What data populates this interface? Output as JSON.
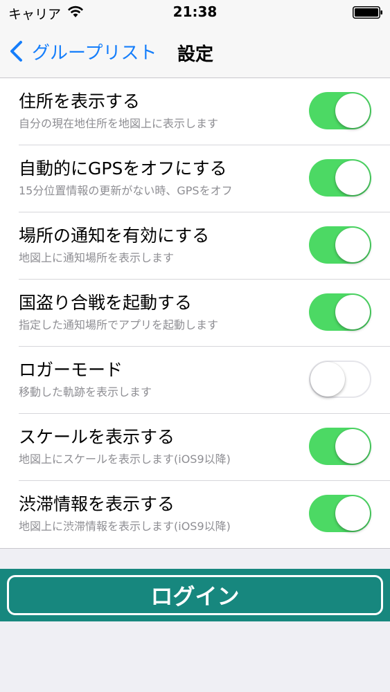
{
  "status_bar": {
    "carrier": "キャリア",
    "time": "21:38",
    "icons": [
      "wifi-icon",
      "battery-icon"
    ]
  },
  "nav": {
    "back_label": "グループリスト",
    "title": "設定",
    "accent_color": "#157efb"
  },
  "settings": [
    {
      "title": "住所を表示する",
      "subtitle": "自分の現在地住所を地図上に表示します",
      "enabled": true
    },
    {
      "title": "自動的にGPSをオフにする",
      "subtitle": "15分位置情報の更新がない時、GPSをオフ",
      "enabled": true
    },
    {
      "title": "場所の通知を有効にする",
      "subtitle": "地図上に通知場所を表示します",
      "enabled": true
    },
    {
      "title": "国盗り合戦を起動する",
      "subtitle": "指定した通知場所でアプリを起動します",
      "enabled": true
    },
    {
      "title": "ロガーモード",
      "subtitle": "移動した軌跡を表示します",
      "enabled": false
    },
    {
      "title": "スケールを表示する",
      "subtitle": "地図上にスケールを表示します(iOS9以降)",
      "enabled": true
    },
    {
      "title": "渋滞情報を表示する",
      "subtitle": "地図上に渋滞情報を表示します(iOS9以降)",
      "enabled": true
    }
  ],
  "toggle_on_color": "#4cd964",
  "login": {
    "label": "ログイン",
    "band_color": "#17877e"
  }
}
